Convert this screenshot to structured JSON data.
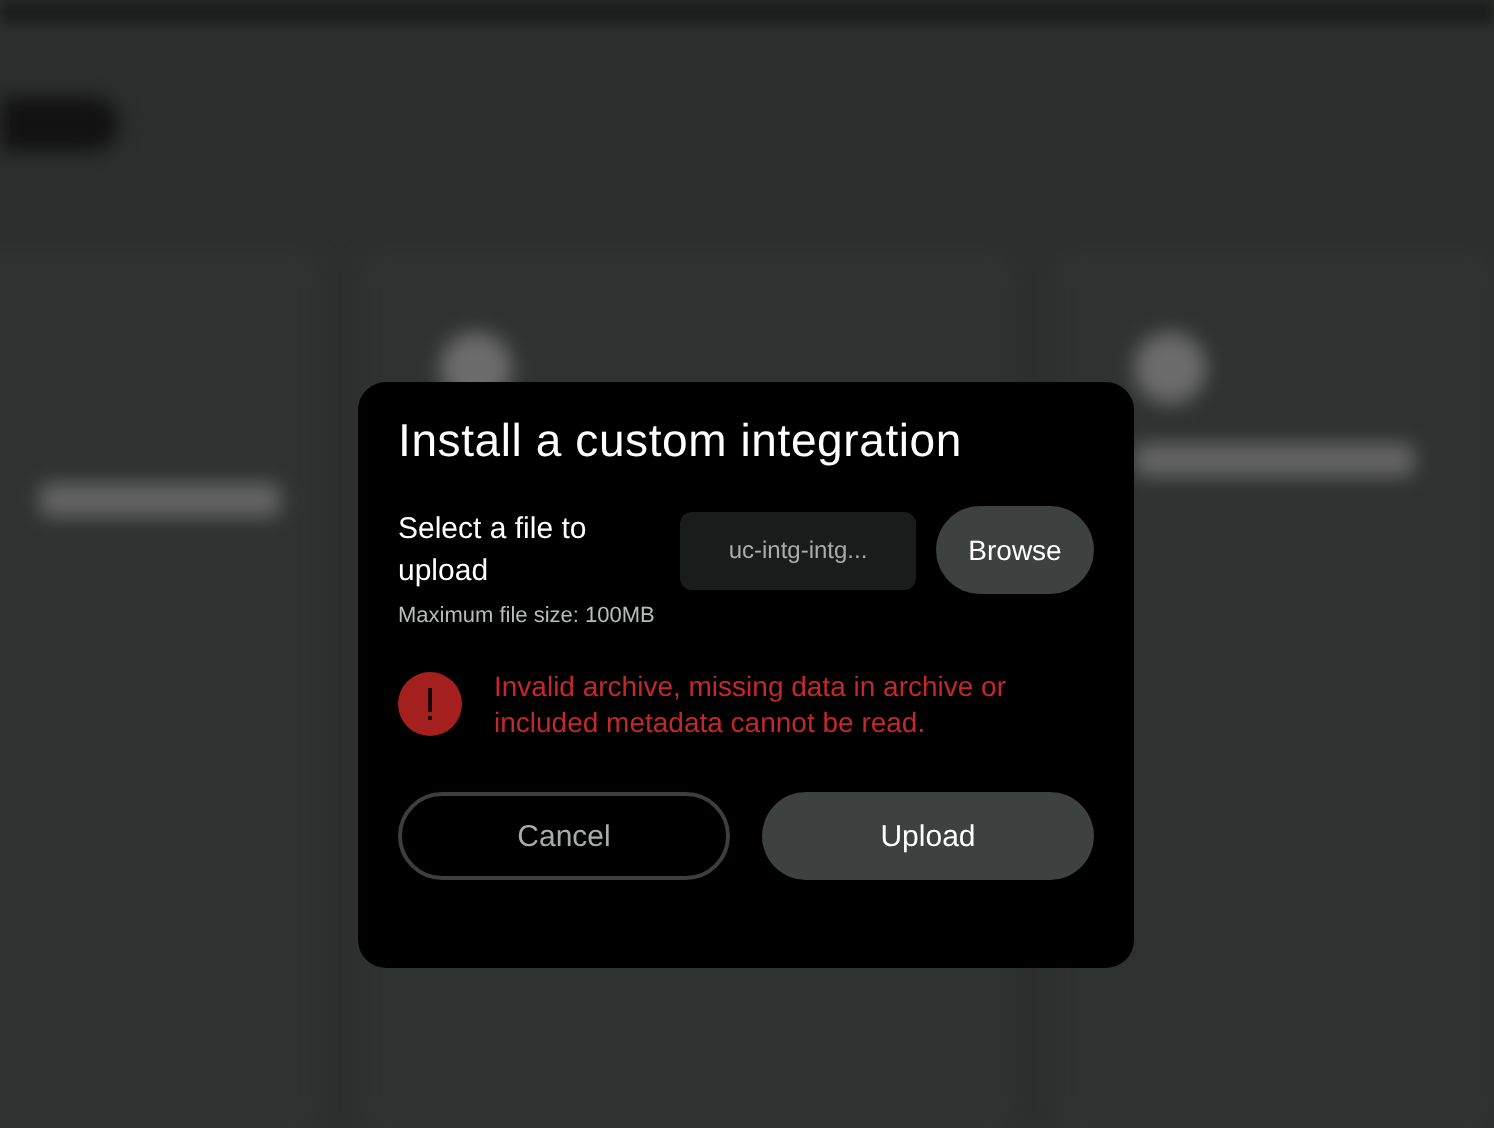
{
  "dialog": {
    "title": "Install a custom integration",
    "file_prompt": "Select a file to upload",
    "size_note": "Maximum file size: 100MB",
    "file_field": {
      "value": "uc-intg-intg..."
    },
    "browse_button": "Browse",
    "error": {
      "message": "Invalid archive, missing data in archive or included metadata cannot be read."
    },
    "buttons": [
      {
        "label": "Cancel",
        "kind": "outline"
      },
      {
        "label": "Upload",
        "kind": "filled"
      }
    ]
  }
}
